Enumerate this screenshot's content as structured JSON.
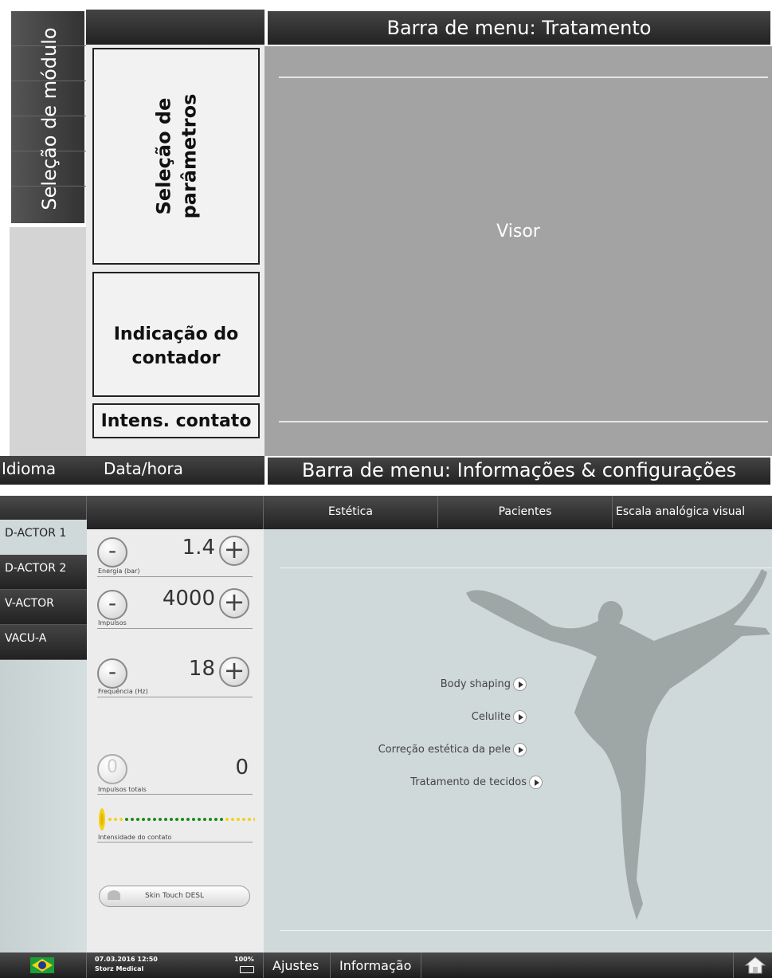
{
  "annotated": {
    "module_selection": "Seleção de módulo",
    "parameter_selection_line1": "Seleção de",
    "parameter_selection_line2": "parâmetros",
    "counter_line1": "Indicação do",
    "counter_line2": "contador",
    "contact": "Intens. contato",
    "menu_treatment": "Barra de menu: Tratamento",
    "display": "Visor",
    "language": "Idioma",
    "datetime": "Data/hora",
    "menu_info": "Barra de menu: Informações & configurações"
  },
  "screen": {
    "tabs": [
      "Estética",
      "Pacientes",
      "Escala analógica visual"
    ],
    "modules": [
      "D-ACTOR 1",
      "D-ACTOR 2",
      "V-ACTOR",
      "VACU-A"
    ],
    "params": [
      {
        "value": "1.4",
        "label": "Energia (bar)"
      },
      {
        "value": "4000",
        "label": "Impulsos"
      },
      {
        "value": "18",
        "label": "Frequência (Hz)"
      }
    ],
    "total_impulses": {
      "value": "0",
      "label": "Impulsos totais"
    },
    "contact_label": "Intensidade do contato",
    "skin_touch": "Skin Touch DESL",
    "menu": [
      "Body shaping",
      "Celulite",
      "Correção estética da pele",
      "Tratamento de tecidos"
    ],
    "status": {
      "datetime": "07.03.2016 12:50",
      "name": "Storz Medical",
      "battery": "100%"
    },
    "bottom_buttons": [
      "Ajustes",
      "Informação"
    ],
    "colors": {
      "panel_bg": "#cfd9d9",
      "dot_green": "#1a8a1a",
      "dot_yellow": "#f2d21a"
    }
  }
}
